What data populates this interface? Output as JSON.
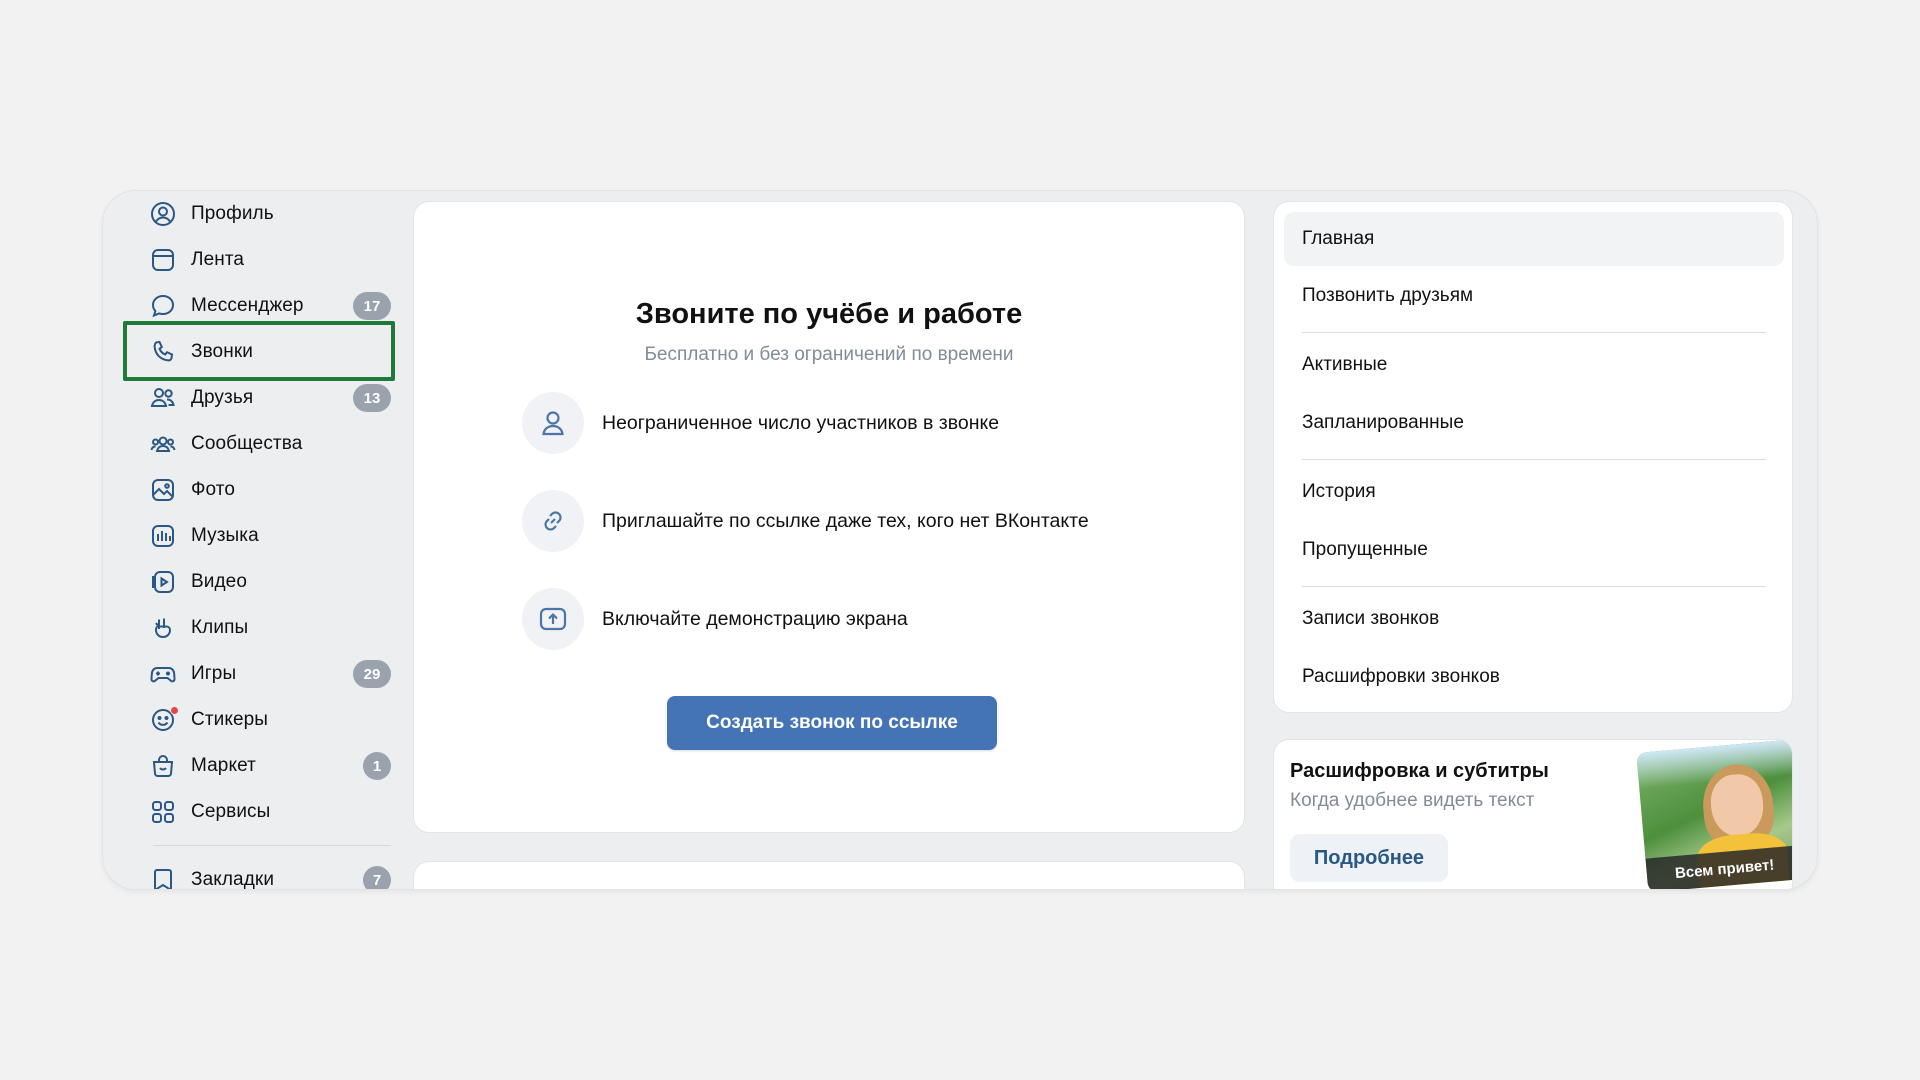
{
  "sidebar": {
    "items": [
      {
        "label": "Профиль",
        "icon": "profile-icon"
      },
      {
        "label": "Лента",
        "icon": "feed-icon"
      },
      {
        "label": "Мессенджер",
        "icon": "messenger-icon",
        "count": "17"
      },
      {
        "label": "Звонки",
        "icon": "phone-icon"
      },
      {
        "label": "Друзья",
        "icon": "friends-icon",
        "count": "13"
      },
      {
        "label": "Сообщества",
        "icon": "communities-icon"
      },
      {
        "label": "Фото",
        "icon": "photo-icon"
      },
      {
        "label": "Музыка",
        "icon": "music-icon"
      },
      {
        "label": "Видео",
        "icon": "video-icon"
      },
      {
        "label": "Клипы",
        "icon": "clips-icon"
      },
      {
        "label": "Игры",
        "icon": "games-icon",
        "count": "29"
      },
      {
        "label": "Стикеры",
        "icon": "stickers-icon"
      },
      {
        "label": "Маркет",
        "icon": "market-icon",
        "count": "1"
      },
      {
        "label": "Сервисы",
        "icon": "services-icon"
      },
      {
        "label": "Закладки",
        "icon": "bookmarks-icon",
        "count": "7"
      }
    ],
    "highlighted": "Звонки"
  },
  "main": {
    "title": "Звоните по учёбе и работе",
    "subtitle": "Бесплатно и без ограничений по времени",
    "features": [
      {
        "text": "Неограниченное число участников в звонке",
        "icon": "person-icon"
      },
      {
        "text": "Приглашайте по ссылке даже тех, кого нет ВКонтакте",
        "icon": "link-icon"
      },
      {
        "text": "Включайте демонстрацию экрана",
        "icon": "screen-share-icon"
      }
    ],
    "create_button": "Создать звонок по ссылке"
  },
  "right_menu": {
    "items": [
      {
        "label": "Главная",
        "active": true
      },
      {
        "label": "Позвонить друзьям"
      },
      {
        "label": "Активные"
      },
      {
        "label": "Запланированные"
      },
      {
        "label": "История"
      },
      {
        "label": "Пропущенные"
      },
      {
        "label": "Записи звонков"
      },
      {
        "label": "Расшифровки звонков"
      }
    ]
  },
  "promo": {
    "title": "Расшифровка и субтитры",
    "subtitle": "Когда удобнее видеть текст",
    "button": "Подробнее",
    "image_caption": "Всем привет!"
  },
  "colors": {
    "accent": "#4574b6",
    "icon": "#2a5885",
    "badge": "#99a2ad",
    "highlight_border": "#1f7a3a",
    "sticker_dot": "#e64646"
  }
}
